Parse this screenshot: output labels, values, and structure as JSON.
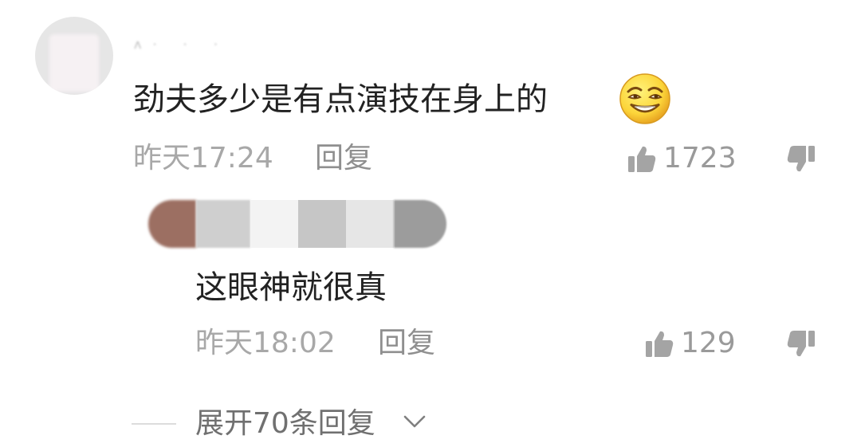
{
  "comment": {
    "username": "ʌ·  ·  ·",
    "text": "劲夫多少是有点演技在身上的",
    "time": "昨天17:24",
    "reply_label": "回复",
    "like_count": "1723",
    "emoji": "grinning-squint-emoji"
  },
  "reply": {
    "text": "这眼神就很真",
    "time": "昨天18:02",
    "reply_label": "回复",
    "like_count": "129"
  },
  "expand": {
    "label": "展开70条回复"
  },
  "colors": {
    "text_primary": "#222222",
    "text_meta": "#a8a8a8",
    "icon": "#9a9a9a"
  }
}
